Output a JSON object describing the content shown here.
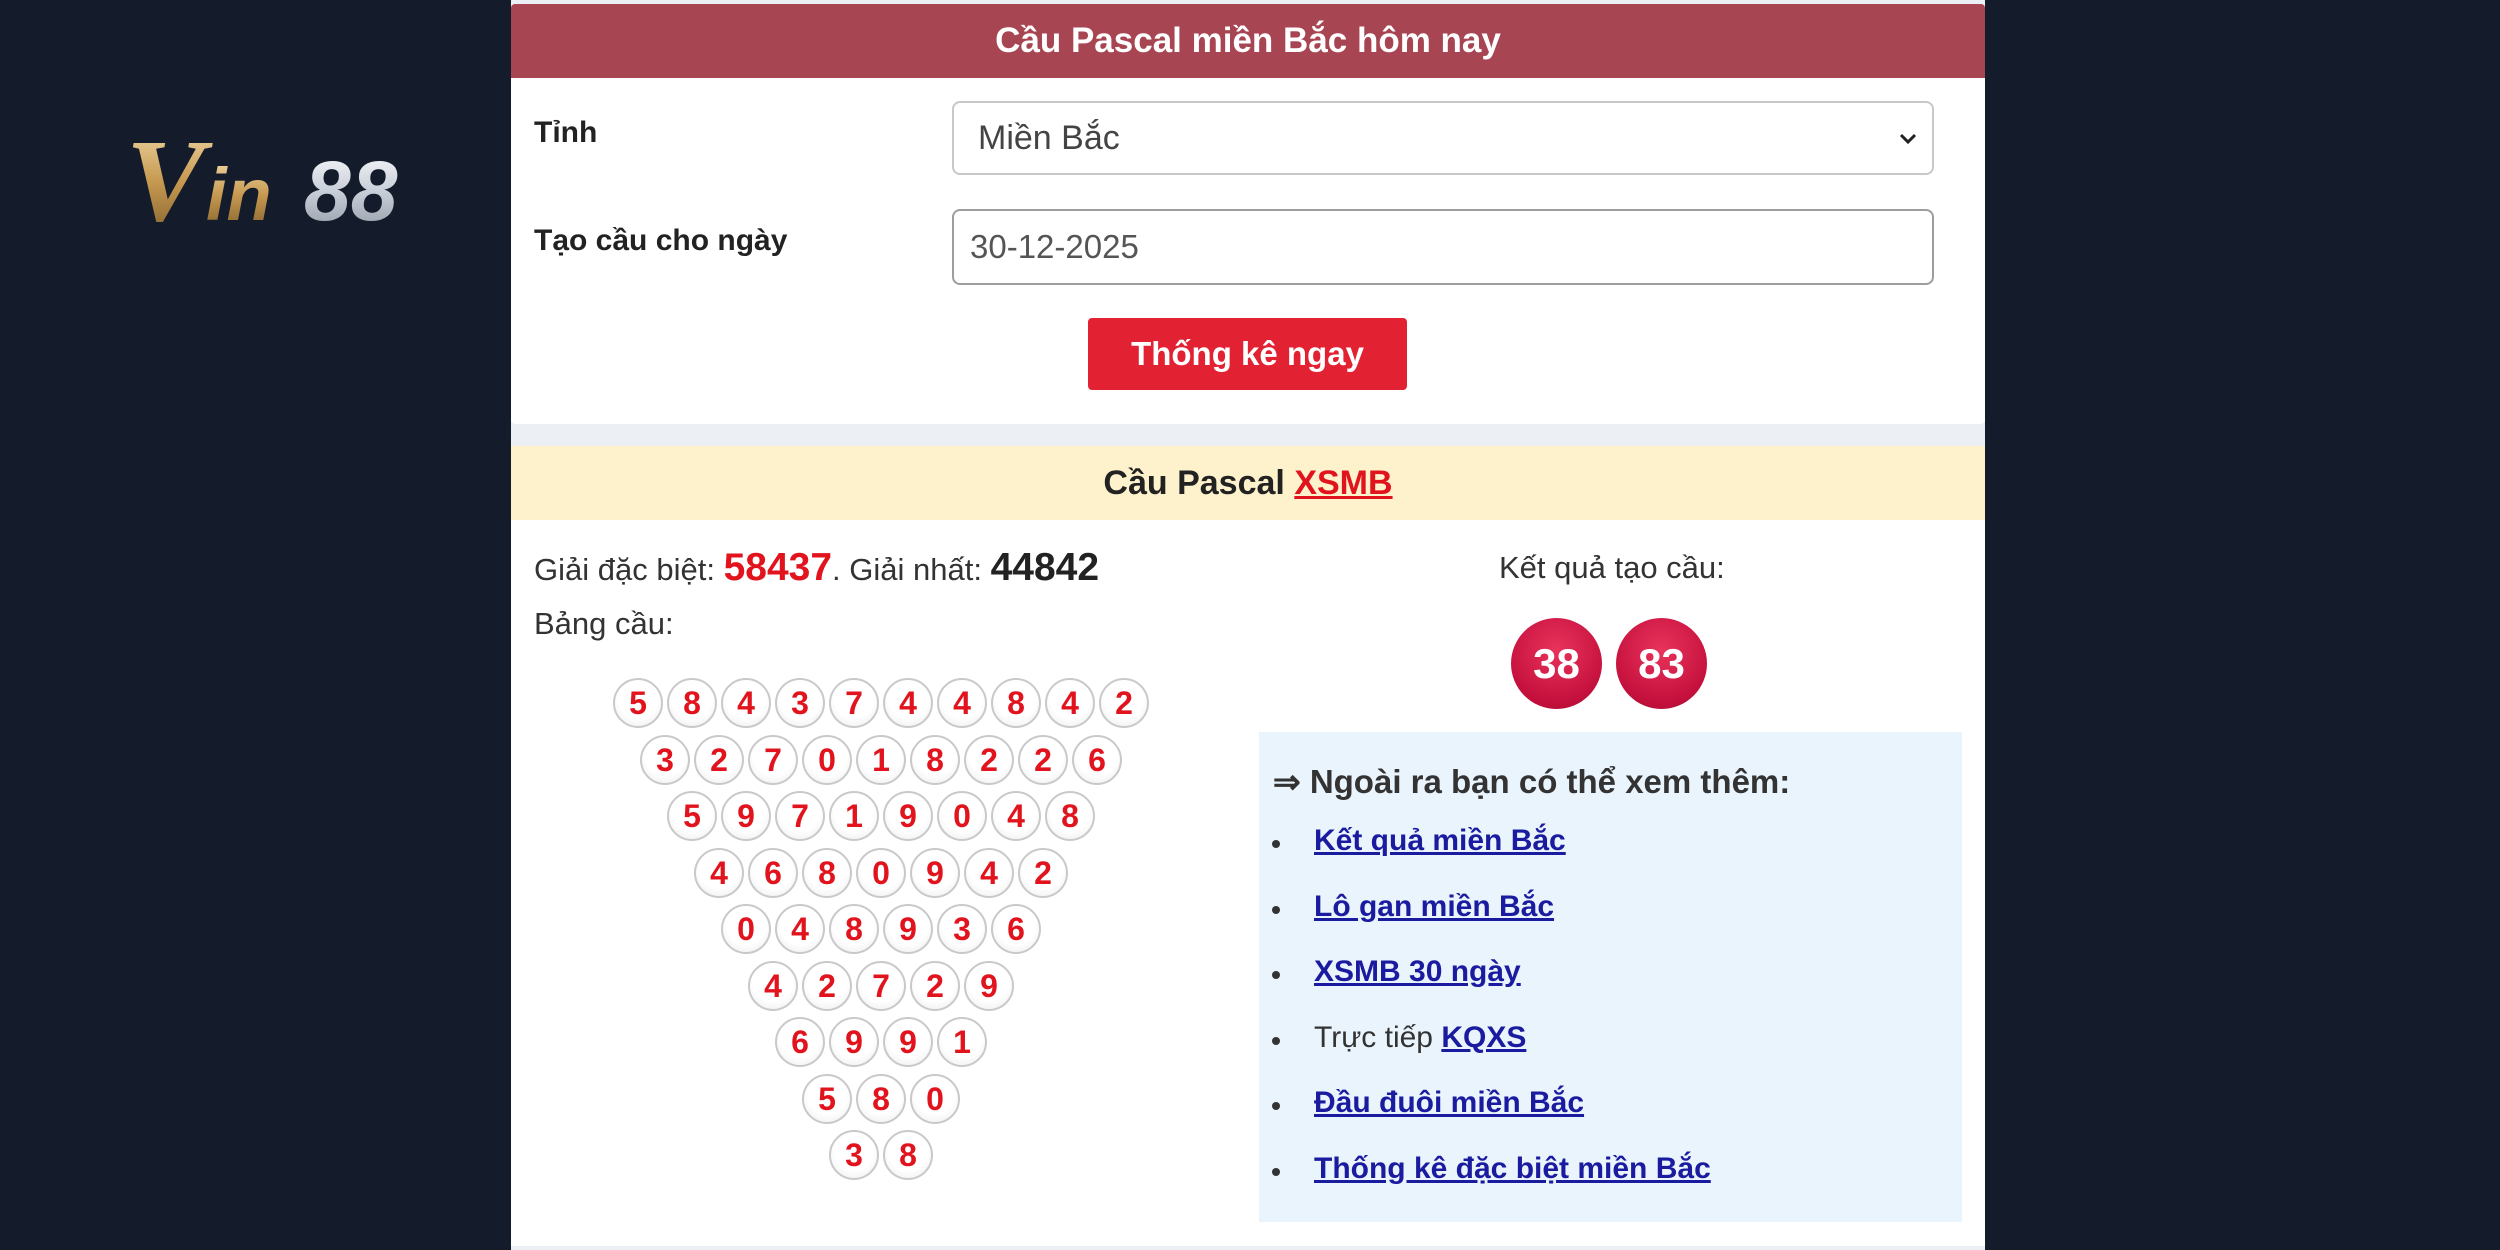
{
  "brand": {
    "logo_text": "Vin88"
  },
  "form": {
    "title": "Cầu Pascal miền Bắc hôm nay",
    "province_label": "Tỉnh",
    "province_value": "Miền Bắc",
    "date_label": "Tạo cầu cho ngày",
    "date_value": "30-12-2025",
    "submit_label": "Thống kê ngay"
  },
  "result": {
    "header_prefix": "Cầu Pascal",
    "header_link": "XSMB",
    "special_label": "Giải đặc biệt:",
    "special_value": "58437",
    "separator": ".",
    "first_label": "Giải nhất:",
    "first_value": "44842",
    "table_label": "Bảng cầu:",
    "pascal_rows": [
      [
        "5",
        "8",
        "4",
        "3",
        "7",
        "4",
        "4",
        "8",
        "4",
        "2"
      ],
      [
        "3",
        "2",
        "7",
        "0",
        "1",
        "8",
        "2",
        "2",
        "6"
      ],
      [
        "5",
        "9",
        "7",
        "1",
        "9",
        "0",
        "4",
        "8"
      ],
      [
        "4",
        "6",
        "8",
        "0",
        "9",
        "4",
        "2"
      ],
      [
        "0",
        "4",
        "8",
        "9",
        "3",
        "6"
      ],
      [
        "4",
        "2",
        "7",
        "2",
        "9"
      ],
      [
        "6",
        "9",
        "9",
        "1"
      ],
      [
        "5",
        "8",
        "0"
      ],
      [
        "3",
        "8"
      ]
    ],
    "outcome_label": "Kết quả tạo cầu:",
    "outcome_numbers": [
      "38",
      "83"
    ]
  },
  "more": {
    "title": "⇒ Ngoài ra bạn có thể xem thêm:",
    "links": [
      {
        "prefix": "",
        "text": "Kết quả miền Bắc"
      },
      {
        "prefix": "",
        "text": "Lô gan miền Bắc"
      },
      {
        "prefix": "",
        "text": "XSMB 30 ngày"
      },
      {
        "prefix": "Trực tiếp ",
        "text": "KQXS"
      },
      {
        "prefix": "",
        "text": "Đầu đuôi miền Bắc"
      },
      {
        "prefix": "",
        "text": "Thống kê đặc biệt miền Bắc"
      }
    ]
  },
  "colors": {
    "page_background": "#141c2c",
    "header_red": "#a84552",
    "button_red": "#e22232",
    "accent_red": "#e1141e",
    "result_ball": "#c4103c",
    "banner_yellow": "#fdf2cc",
    "more_box_blue": "#eaf4fc",
    "link_blue": "#1b1ba0"
  }
}
